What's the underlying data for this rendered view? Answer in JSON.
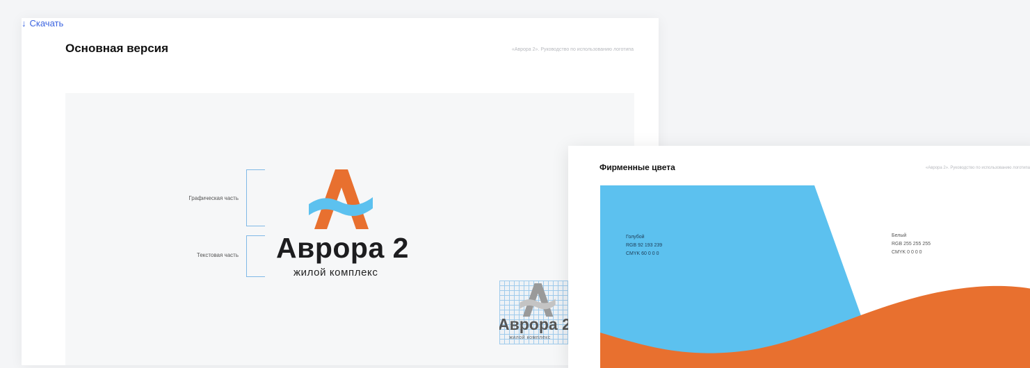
{
  "main_card": {
    "title": "Основная версия",
    "breadcrumb": "«Аврора 2». Руководство по использованию логотипа",
    "download_label": "Скачать",
    "download_icon": "arrow-down-icon",
    "labels": {
      "graphic": "Графическая часть",
      "text": "Текстовая часть"
    },
    "logo": {
      "name": "Аврора 2",
      "subtitle": "жилой комплекс"
    },
    "grid_logo": {
      "name": "Аврора 2",
      "subtitle": "жилой комплекс"
    }
  },
  "colors_card": {
    "title": "Фирменные цвета",
    "breadcrumb": "«Аврора 2». Руководство по использованию логотипа",
    "swatches": [
      {
        "name": "Голубой",
        "rgb": "RGB 92 193 239",
        "cmyk": "CMYK 60 0 0 0",
        "hex": "#5cc1ef"
      },
      {
        "name": "Белый",
        "rgb": "RGB 255 255 255",
        "cmyk": "CMYK 0 0 0 0",
        "hex": "#ffffff"
      }
    ],
    "accent_orange": "#e8702f"
  },
  "colors": {
    "link": "#3a63e0",
    "logo_orange": "#e8702f",
    "logo_blue": "#5cc1ef"
  }
}
